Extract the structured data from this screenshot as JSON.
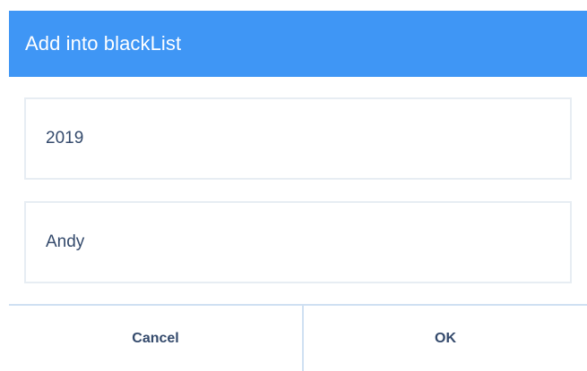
{
  "dialog": {
    "title": "Add into blackList",
    "fields": [
      {
        "value": "2019",
        "placeholder": ""
      },
      {
        "value": "Andy",
        "placeholder": ""
      }
    ],
    "buttons": {
      "cancel_label": "Cancel",
      "ok_label": "OK"
    }
  },
  "colors": {
    "header": "#3f96f5",
    "text": "#344a6c",
    "border": "#e7edf3",
    "divider": "#cfe0f2"
  }
}
